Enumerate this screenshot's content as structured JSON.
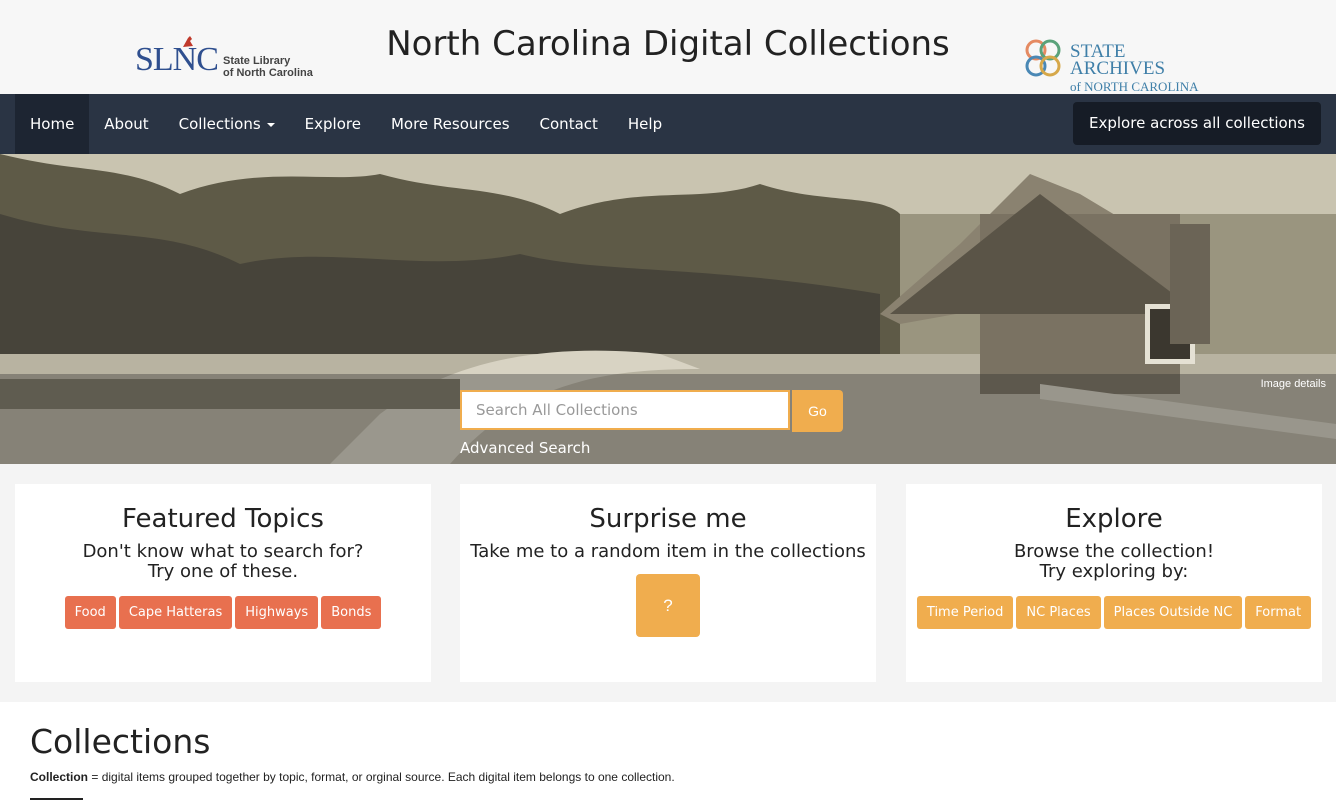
{
  "header": {
    "title": "North Carolina Digital Collections",
    "left_logo": {
      "mark": "SLNC",
      "line1": "State Library",
      "line2": "of North Carolina"
    },
    "right_logo": {
      "line1": "STATE ARCHIVES",
      "line2": "of NORTH CAROLINA"
    }
  },
  "nav": {
    "items": [
      {
        "label": "Home"
      },
      {
        "label": "About"
      },
      {
        "label": "Collections"
      },
      {
        "label": "Explore"
      },
      {
        "label": "More Resources"
      },
      {
        "label": "Contact"
      },
      {
        "label": "Help"
      }
    ],
    "explore_all": "Explore across all collections"
  },
  "hero": {
    "image_details": "Image details",
    "search_placeholder": "Search All Collections",
    "go_label": "Go",
    "advanced_search": "Advanced Search"
  },
  "featured": {
    "title": "Featured Topics",
    "line1": "Don't know what to search for?",
    "line2": "Try one of these.",
    "topics": [
      "Food",
      "Cape Hatteras",
      "Highways",
      "Bonds"
    ]
  },
  "surprise": {
    "title": "Surprise me",
    "line1": "Take me to a random item in the collections",
    "button": "?"
  },
  "explore": {
    "title": "Explore",
    "line1": "Browse the collection!",
    "line2": "Try exploring by:",
    "options": [
      "Time Period",
      "NC Places",
      "Places Outside NC",
      "Format"
    ]
  },
  "collections": {
    "title": "Collections",
    "term": "Collection",
    "definition": " = digital items grouped together by topic, format, or orginal source. Each digital item belongs to one collection."
  },
  "colors": {
    "navbar": "#2a3444",
    "accent_orange": "#f0ad4e",
    "accent_red": "#e8704f"
  }
}
